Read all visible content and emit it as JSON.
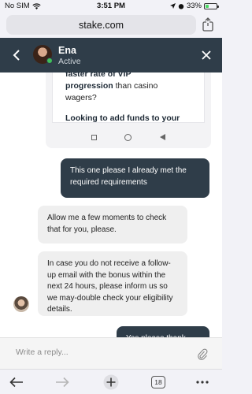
{
  "status_bar": {
    "carrier": "No SIM",
    "time": "3:51 PM",
    "battery": "33%",
    "battery_level": 0.33
  },
  "browser": {
    "url": "stake.com",
    "tab_count": "18"
  },
  "chat_header": {
    "agent_name": "Ena",
    "agent_status": "Active"
  },
  "shared_screenshot": {
    "line1_bold": "faster rate of VIP",
    "line2_bold": "progression",
    "line2_rest": " than casino",
    "line3": "wagers?",
    "line4": "Looking to add funds to your"
  },
  "messages": [
    {
      "sender": "user",
      "text": "This one please I already met the required requirements"
    },
    {
      "sender": "agent",
      "text": "Allow me a few moments to check that for you, please."
    },
    {
      "sender": "agent",
      "text": "In case you do not receive a follow-up email with the bonus within the next 24 hours, please inform us so we may-double check your eligibility details."
    },
    {
      "sender": "user",
      "text": "Yes please thank you"
    }
  ],
  "composer": {
    "placeholder": "Write a reply..."
  },
  "colors": {
    "header_bg": "#2f3d49",
    "user_bubble": "#2f3d49",
    "agent_bubble": "#efefef",
    "online": "#3fbf5a"
  }
}
